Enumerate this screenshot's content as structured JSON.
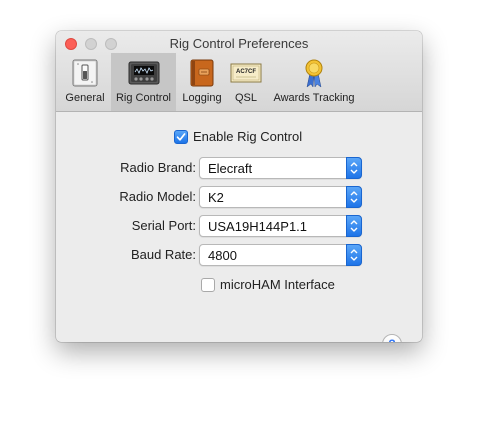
{
  "window": {
    "title": "Rig Control Preferences"
  },
  "toolbar": {
    "items": [
      {
        "label": "General",
        "icon": "switch-icon"
      },
      {
        "label": "Rig Control",
        "icon": "radio-icon"
      },
      {
        "label": "Logging",
        "icon": "logbook-icon"
      },
      {
        "label": "QSL",
        "icon": "qsl-card-icon",
        "card_text": "AC7CF"
      },
      {
        "label": "Awards Tracking",
        "icon": "award-ribbon-icon"
      }
    ],
    "selected": "Rig Control"
  },
  "enable_rig_control": {
    "label": "Enable Rig Control",
    "checked": true
  },
  "fields": [
    {
      "label": "Radio Brand:",
      "value": "Elecraft"
    },
    {
      "label": "Radio Model:",
      "value": "K2"
    },
    {
      "label": "Serial Port:",
      "value": "USA19H144P1.1"
    },
    {
      "label": "Baud Rate:",
      "value": "4800"
    }
  ],
  "microham": {
    "label": "microHAM Interface",
    "checked": false
  },
  "help": {
    "label": "?"
  },
  "colors": {
    "accent": "#3478f6",
    "close_button": "#fc5f57"
  }
}
